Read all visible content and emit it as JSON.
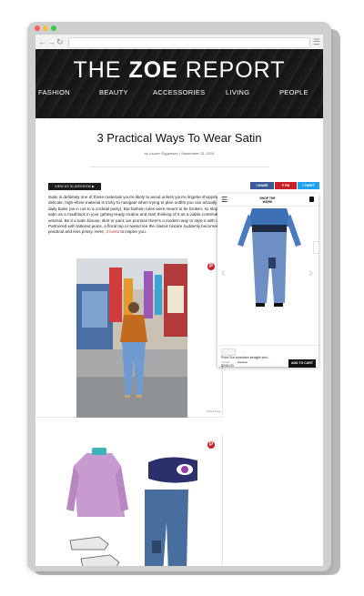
{
  "browser": {
    "back_icon": "back-arrow-icon",
    "forward_icon": "forward-arrow-icon",
    "reload_icon": "reload-icon",
    "menu_icon": "hamburger-menu-icon"
  },
  "header": {
    "logo_the": "THE ",
    "logo_zoe": "ZOE",
    "logo_report": " REPORT",
    "nav": [
      "FASHION",
      "BEAUTY",
      "ACCESSORIES",
      "LIVING",
      "PEOPLE"
    ]
  },
  "article": {
    "title": "3 Practical Ways To Wear Satin",
    "byline": "by Lauren Eggertsen | September 23, 2015",
    "slideshow_label": "VIEW AS SLIDESHOW",
    "body_before_link": "Satin is definitely one of those materials you're likely to avoid unless you're lingerie shopping. The delicate, high-shine material is tricky to navigate when trying to plan outfits you can actually wear on a daily basis (as in not to a cocktail party). But fashion rules were meant to be broken, so stop thinking of satin as a roadblock in your getting-ready routine and start thinking of it as a viable contender in your fall arsenal. Be it a satin blouse, skirt or pant, we promise there's a modern way to style it with aplomb. Partnered with tattered jeans, a floral top or tweed tee the classic texture suddenly becomes more practical and less prissy. Here, ",
    "body_link": "3 looks",
    "body_after_link": " to inspire you.",
    "photo_credit": "Street Peep"
  },
  "share": {
    "facebook": "SHARE",
    "pinterest": "PIN",
    "twitter": "TWEET"
  },
  "shop_widget": {
    "logo": "SHOP THE WORK",
    "product_name": "Point Sur shredded straight selv...",
    "brand": "J.Crew",
    "original_price": "$135.00",
    "price": "$298.00",
    "add_to_cart": "ADD TO CART"
  },
  "colors": {
    "accent_red": "#cb2027",
    "facebook_blue": "#3b5998",
    "twitter_blue": "#1da1f2",
    "header_black": "#111111"
  }
}
